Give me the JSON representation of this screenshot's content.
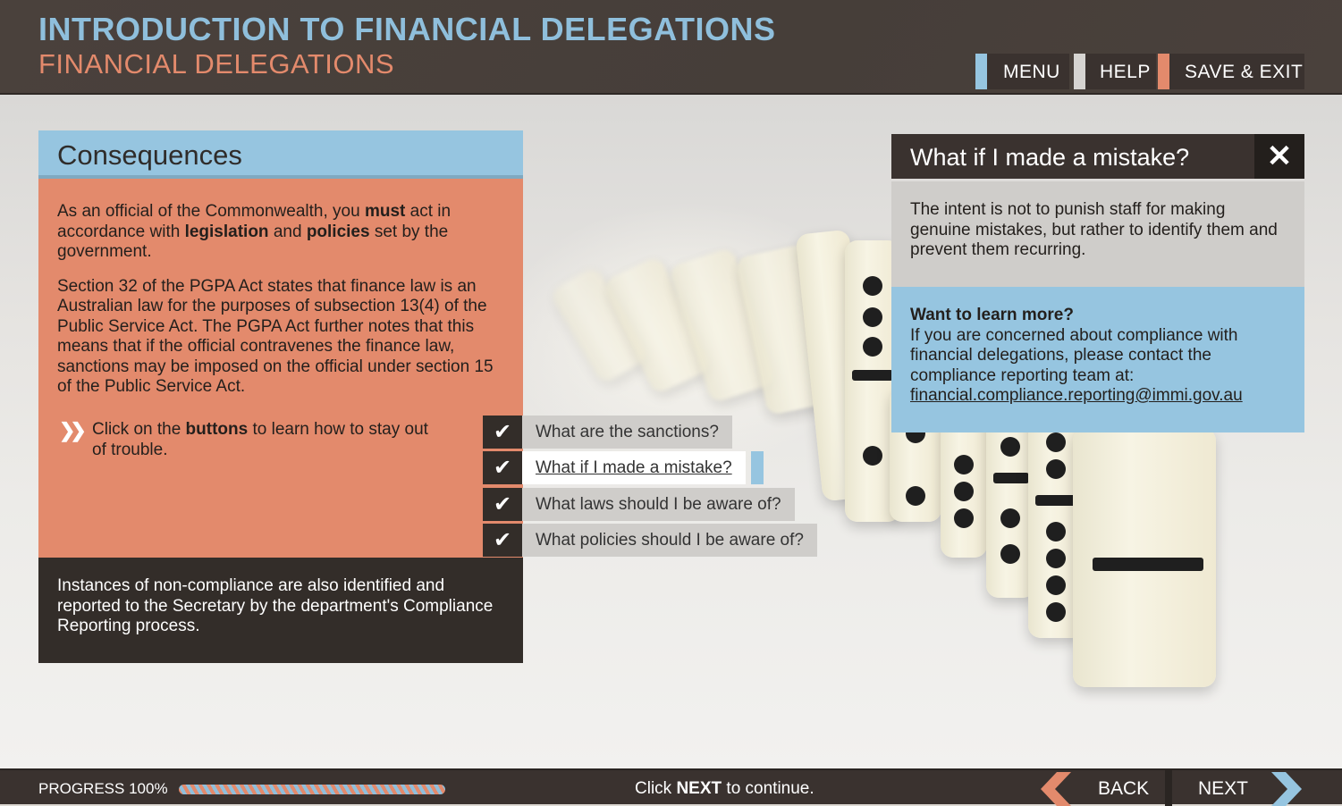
{
  "header": {
    "course_title": "INTRODUCTION TO FINANCIAL DELEGATIONS",
    "module_title": "FINANCIAL DELEGATIONS",
    "nav": [
      {
        "label": "MENU",
        "accent": "#96c5e0"
      },
      {
        "label": "HELP",
        "accent": "#d6d4d1"
      },
      {
        "label": "SAVE & EXIT",
        "accent": "#e38a6c"
      }
    ]
  },
  "consequences": {
    "heading": "Consequences",
    "p1": {
      "a": "As an official of the Commonwealth, you ",
      "b": "must",
      "c": " act in accordance with ",
      "d": "legislation",
      "e": " and ",
      "f": "policies",
      "g": " set by the government."
    },
    "p2": "Section 32 of the PGPA Act states that finance law is an Australian law for the purposes of subsection 13(4) of the Public Service Act. The PGPA Act further notes that this means that if the official contravenes the finance law, sanctions may be imposed on the official under section 15 of the Public Service Act.",
    "cta": {
      "a": "Click on the ",
      "b": "buttons",
      "c": " to learn how to stay out of trouble."
    },
    "footer_text": "Instances of non-compliance are also identified and reported to the Secretary by the department's Compliance Reporting process."
  },
  "options": [
    {
      "label": "What are the sanctions?",
      "checked": true
    },
    {
      "label": "What if I made a mistake?",
      "checked": true,
      "active": true
    },
    {
      "label": "What laws should I be aware of?",
      "checked": true
    },
    {
      "label": "What policies should I be aware of?",
      "checked": true
    }
  ],
  "popup": {
    "title": "What if I made a mistake?",
    "close_icon": "close-icon",
    "body": "The intent is not to punish staff for making genuine mistakes, but rather to identify them and prevent them recurring.",
    "more_heading": "Want to learn more?",
    "more_text": "If you are concerned about compliance with financial delegations, please contact the compliance reporting team at:",
    "email": "financial.compliance.reporting@immi.gov.au"
  },
  "footer": {
    "progress_label": "PROGRESS 100%",
    "progress": 1.0,
    "continue": {
      "a": "Click ",
      "b": "NEXT",
      "c": " to continue."
    },
    "back_label": "BACK",
    "next_label": "NEXT"
  },
  "colors": {
    "blue": "#96c5e0",
    "salmon": "#e38a6c",
    "dark": "#3a322f"
  }
}
